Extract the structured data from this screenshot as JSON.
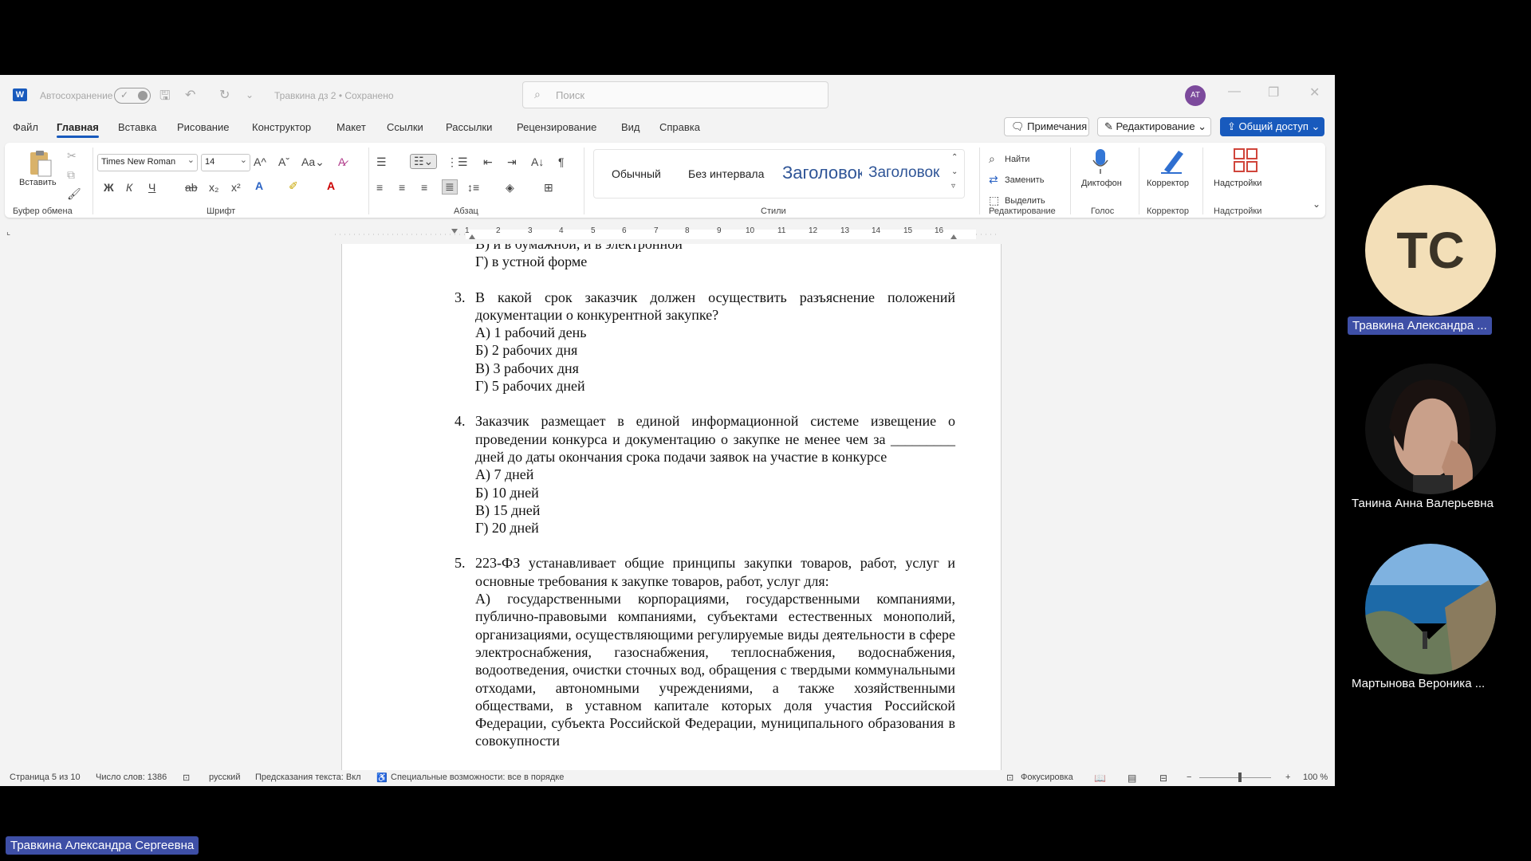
{
  "titlebar": {
    "app_icon": "W",
    "autosave_label": "Автосохранение",
    "doc_title": "Травкина дз 2 • Сохранено",
    "search_placeholder": "Поиск",
    "user_initials": "AT"
  },
  "menu": {
    "items": [
      "Файл",
      "Главная",
      "Вставка",
      "Рисование",
      "Конструктор",
      "Макет",
      "Ссылки",
      "Рассылки",
      "Рецензирование",
      "Вид",
      "Справка"
    ],
    "active": "Главная",
    "comments": "Примечания",
    "editing": "Редактирование",
    "share": "Общий доступ"
  },
  "ribbon": {
    "paste_label": "Вставить",
    "clipboard_group": "Буфер обмена",
    "font_name": "Times New Roman",
    "font_size": "14",
    "font_group": "Шрифт",
    "paragraph_group": "Абзац",
    "styles": [
      "Обычный",
      "Без интервала",
      "Заголовок",
      "Заголовок"
    ],
    "styles_group": "Стили",
    "find": "Найти",
    "replace": "Заменить",
    "select": "Выделить",
    "editing_group": "Редактирование",
    "dictate": "Диктофон",
    "voice_group": "Голос",
    "editor": "Корректор",
    "editor_group": "Корректор",
    "addins": "Надстройки",
    "addins_group": "Надстройки",
    "format_buttons": {
      "bold": "Ж",
      "italic": "К",
      "underline": "Ч"
    }
  },
  "ruler_numbers": [
    "1",
    "2",
    "3",
    "4",
    "5",
    "6",
    "7",
    "8",
    "9",
    "10",
    "11",
    "12",
    "13",
    "14",
    "15",
    "16"
  ],
  "document": {
    "lead_lines": [
      "В) и в бумажной, и в электронной",
      "Г) в устной форме"
    ],
    "questions": [
      {
        "num": "3.",
        "stem": "В какой срок заказчик должен осуществить разъяснение положений документации о конкурентной закупке?",
        "options": [
          "А) 1 рабочий день",
          "Б) 2 рабочих дня",
          "В) 3 рабочих дня",
          "Г) 5 рабочих дней"
        ]
      },
      {
        "num": "4.",
        "stem": "Заказчик размещает в единой информационной системе извещение о проведении конкурса и документацию о закупке не менее чем за _________ дней до даты окончания срока подачи заявок на участие в конкурсе",
        "options": [
          "А) 7 дней",
          "Б) 10 дней",
          "В) 15 дней",
          "Г) 20 дней"
        ]
      },
      {
        "num": "5.",
        "stem": "223-ФЗ устанавливает общие принципы закупки товаров, работ, услуг и основные требования к закупке товаров, работ, услуг для:",
        "options": [
          "А) государственными корпорациями, государственными компаниями, публично-правовыми компаниями, субъектами естественных монополий, организациями, осуществляющими регулируемые виды деятельности в сфере электроснабжения, газоснабжения, теплоснабжения, водоснабжения, водоотведения, очистки сточных вод, обращения с твердыми коммунальными отходами, автономными учреждениями, а также хозяйственными обществами, в уставном капитале которых доля участия Российской Федерации, субъекта Российской Федерации, муниципального образования в совокупности"
        ]
      }
    ]
  },
  "status": {
    "page": "Страница 5 из 10",
    "words": "Число слов: 1386",
    "language": "русский",
    "predictions": "Предсказания текста: Вкл",
    "accessibility": "Специальные возможности: все в порядке",
    "focus": "Фокусировка",
    "zoom": "100 %"
  },
  "participants": [
    {
      "initials": "TC",
      "name": "Травкина Александра ..."
    },
    {
      "name": "Танина Анна Валерьевна"
    },
    {
      "name": "Мартынова Вероника ..."
    }
  ],
  "speaker_label": "Травкина Александра Сергеевна",
  "colors": {
    "accent": "#185abd",
    "name_highlight": "#3e4fa6",
    "avatar_tc": "#f3dfb8"
  }
}
